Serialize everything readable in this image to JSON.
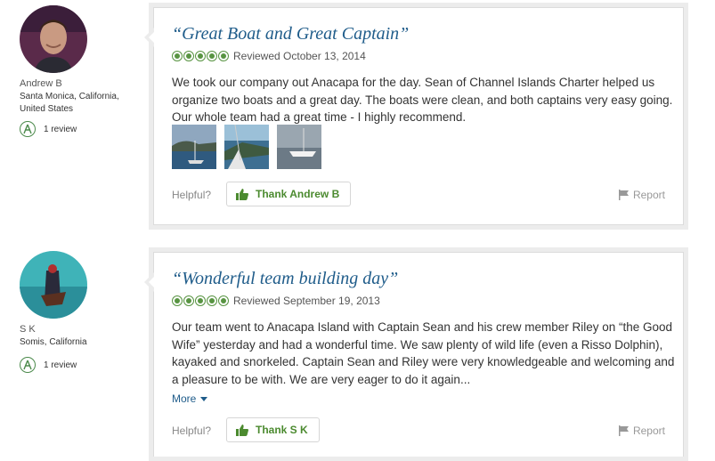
{
  "reviews": [
    {
      "member": {
        "name": "Andrew B",
        "location": "Santa Monica, California, United States",
        "review_count": "1 review"
      },
      "title": "“Great Boat and Great Captain”",
      "rating": 5,
      "reviewed_date": "Reviewed October 13, 2014",
      "body": "We took our company out Anacapa for the day. Sean of Channel Islands Charter helped us organize two boats and a great day. The boats were clean, and both captains very easy going. Our whole team had a great time - I highly recommend.",
      "photo_count": 3,
      "helpful_label": "Helpful?",
      "thank_label": "Thank Andrew B",
      "report_label": "Report"
    },
    {
      "member": {
        "name": "S K",
        "location": "Somis, California",
        "review_count": "1 review"
      },
      "title": "“Wonderful team building day”",
      "rating": 5,
      "reviewed_date": "Reviewed September 19, 2013",
      "body": "Our team went to Anacapa Island with Captain Sean and his crew member Riley on “the Good Wife” yesterday and had a wonderful time. We saw plenty of wild life (even a Risso Dolphin), kayaked and snorkeled. Captain Sean and Riley were very knowledgeable and welcoming and a pleasure to be with. We are very eager to do it again...",
      "more_label": "More",
      "helpful_label": "Helpful?",
      "thank_label": "Thank S K",
      "report_label": "Report"
    }
  ],
  "colors": {
    "title": "#1f5c8a",
    "rating_green": "#589442",
    "thank_green": "#4b8a2f",
    "card_frame": "#ececec"
  },
  "icons": [
    "thumbs-up-icon",
    "flag-icon",
    "bubble-rating-icon",
    "reviewer-badge-icon"
  ]
}
